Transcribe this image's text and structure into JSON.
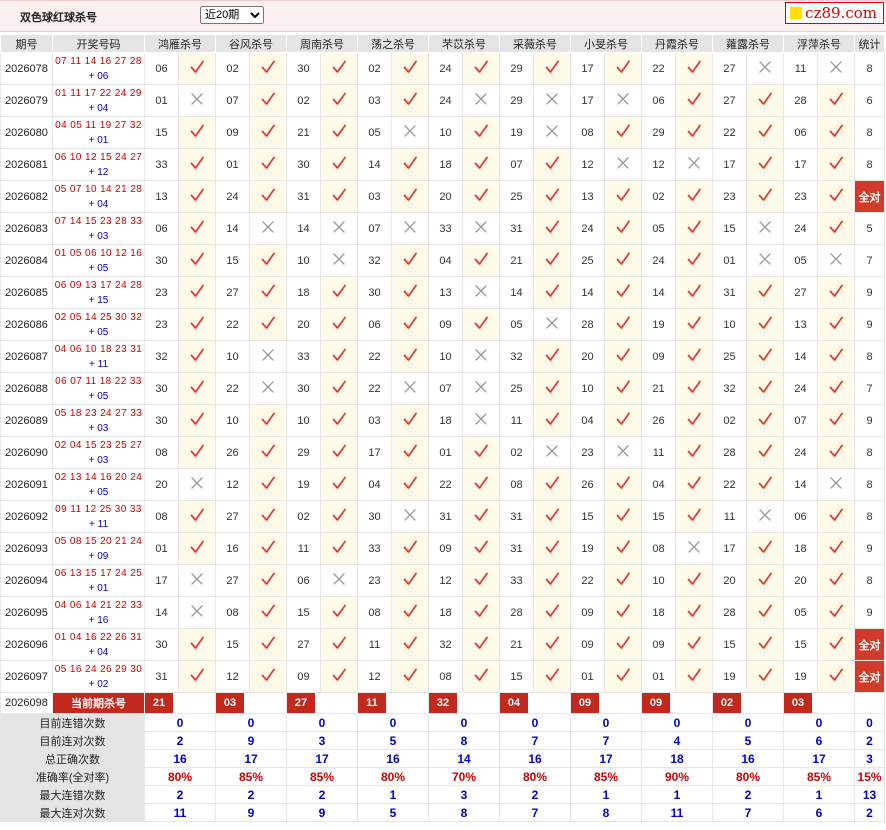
{
  "header": {
    "title": "双色球红球杀号",
    "period_select": {
      "selected": "近20期",
      "options": [
        "近20期"
      ]
    },
    "logo": "cz89.com"
  },
  "columns": [
    "期号",
    "开奖号码",
    "鸿雁杀号",
    "谷风杀号",
    "周南杀号",
    "荡之杀号",
    "芣苡杀号",
    "采薇杀号",
    "小旻杀号",
    "丹霞杀号",
    "蕹露杀号",
    "浮萍杀号",
    "统计"
  ],
  "rows": [
    {
      "issue": "2026078",
      "red": "07 11 14 16 27 28",
      "blue": "+ 06",
      "picks": [
        [
          "06",
          1
        ],
        [
          "02",
          1
        ],
        [
          "30",
          1
        ],
        [
          "02",
          1
        ],
        [
          "24",
          1
        ],
        [
          "29",
          1
        ],
        [
          "17",
          1
        ],
        [
          "22",
          1
        ],
        [
          "27",
          0
        ],
        [
          "11",
          0
        ]
      ],
      "stat": "8"
    },
    {
      "issue": "2026079",
      "red": "01 11 17 22 24 29",
      "blue": "+ 04",
      "picks": [
        [
          "01",
          0
        ],
        [
          "07",
          1
        ],
        [
          "02",
          1
        ],
        [
          "03",
          1
        ],
        [
          "24",
          0
        ],
        [
          "29",
          0
        ],
        [
          "17",
          0
        ],
        [
          "06",
          1
        ],
        [
          "27",
          1
        ],
        [
          "28",
          1
        ]
      ],
      "stat": "6"
    },
    {
      "issue": "2026080",
      "red": "04 05 11 19 27 32",
      "blue": "+ 01",
      "picks": [
        [
          "15",
          1
        ],
        [
          "09",
          1
        ],
        [
          "21",
          1
        ],
        [
          "05",
          0
        ],
        [
          "10",
          1
        ],
        [
          "19",
          0
        ],
        [
          "08",
          1
        ],
        [
          "29",
          1
        ],
        [
          "22",
          1
        ],
        [
          "06",
          1
        ]
      ],
      "stat": "8"
    },
    {
      "issue": "2026081",
      "red": "06 10 12 15 24 27",
      "blue": "+ 12",
      "picks": [
        [
          "33",
          1
        ],
        [
          "01",
          1
        ],
        [
          "30",
          1
        ],
        [
          "14",
          1
        ],
        [
          "18",
          1
        ],
        [
          "07",
          1
        ],
        [
          "12",
          0
        ],
        [
          "12",
          0
        ],
        [
          "17",
          1
        ],
        [
          "17",
          1
        ]
      ],
      "stat": "8"
    },
    {
      "issue": "2026082",
      "red": "05 07 10 14 21 28",
      "blue": "+ 04",
      "picks": [
        [
          "13",
          1
        ],
        [
          "24",
          1
        ],
        [
          "31",
          1
        ],
        [
          "03",
          1
        ],
        [
          "20",
          1
        ],
        [
          "25",
          1
        ],
        [
          "13",
          1
        ],
        [
          "02",
          1
        ],
        [
          "23",
          1
        ],
        [
          "23",
          1
        ]
      ],
      "stat": "全对"
    },
    {
      "issue": "2026083",
      "red": "07 14 15 23 28 33",
      "blue": "+ 03",
      "picks": [
        [
          "06",
          1
        ],
        [
          "14",
          0
        ],
        [
          "14",
          0
        ],
        [
          "07",
          0
        ],
        [
          "33",
          0
        ],
        [
          "31",
          1
        ],
        [
          "24",
          1
        ],
        [
          "05",
          1
        ],
        [
          "15",
          0
        ],
        [
          "24",
          1
        ]
      ],
      "stat": "5"
    },
    {
      "issue": "2026084",
      "red": "01 05 06 10 12 16",
      "blue": "+ 05",
      "picks": [
        [
          "30",
          1
        ],
        [
          "15",
          1
        ],
        [
          "10",
          0
        ],
        [
          "32",
          1
        ],
        [
          "04",
          1
        ],
        [
          "21",
          1
        ],
        [
          "25",
          1
        ],
        [
          "24",
          1
        ],
        [
          "01",
          0
        ],
        [
          "05",
          0
        ]
      ],
      "stat": "7"
    },
    {
      "issue": "2026085",
      "red": "06 09 13 17 24 28",
      "blue": "+ 15",
      "picks": [
        [
          "23",
          1
        ],
        [
          "27",
          1
        ],
        [
          "18",
          1
        ],
        [
          "30",
          1
        ],
        [
          "13",
          0
        ],
        [
          "14",
          1
        ],
        [
          "14",
          1
        ],
        [
          "14",
          1
        ],
        [
          "31",
          1
        ],
        [
          "27",
          1
        ]
      ],
      "stat": "9"
    },
    {
      "issue": "2026086",
      "red": "02 05 14 25 30 32",
      "blue": "+ 05",
      "picks": [
        [
          "23",
          1
        ],
        [
          "22",
          1
        ],
        [
          "20",
          1
        ],
        [
          "06",
          1
        ],
        [
          "09",
          1
        ],
        [
          "05",
          0
        ],
        [
          "28",
          1
        ],
        [
          "19",
          1
        ],
        [
          "10",
          1
        ],
        [
          "13",
          1
        ]
      ],
      "stat": "9"
    },
    {
      "issue": "2026087",
      "red": "04 06 10 18 23 31",
      "blue": "+ 11",
      "picks": [
        [
          "32",
          1
        ],
        [
          "10",
          0
        ],
        [
          "33",
          1
        ],
        [
          "22",
          1
        ],
        [
          "10",
          0
        ],
        [
          "32",
          1
        ],
        [
          "20",
          1
        ],
        [
          "09",
          1
        ],
        [
          "25",
          1
        ],
        [
          "14",
          1
        ]
      ],
      "stat": "8"
    },
    {
      "issue": "2026088",
      "red": "06 07 11 18 22 33",
      "blue": "+ 05",
      "picks": [
        [
          "30",
          1
        ],
        [
          "22",
          0
        ],
        [
          "30",
          1
        ],
        [
          "22",
          0
        ],
        [
          "07",
          0
        ],
        [
          "25",
          1
        ],
        [
          "10",
          1
        ],
        [
          "21",
          1
        ],
        [
          "32",
          1
        ],
        [
          "24",
          1
        ]
      ],
      "stat": "7"
    },
    {
      "issue": "2026089",
      "red": "05 18 23 24 27 33",
      "blue": "+ 03",
      "picks": [
        [
          "30",
          1
        ],
        [
          "10",
          1
        ],
        [
          "10",
          1
        ],
        [
          "03",
          1
        ],
        [
          "18",
          0
        ],
        [
          "11",
          1
        ],
        [
          "04",
          1
        ],
        [
          "26",
          1
        ],
        [
          "02",
          1
        ],
        [
          "07",
          1
        ]
      ],
      "stat": "9"
    },
    {
      "issue": "2026090",
      "red": "02 04 15 23 25 27",
      "blue": "+ 03",
      "picks": [
        [
          "08",
          1
        ],
        [
          "26",
          1
        ],
        [
          "29",
          1
        ],
        [
          "17",
          1
        ],
        [
          "01",
          1
        ],
        [
          "02",
          0
        ],
        [
          "23",
          0
        ],
        [
          "11",
          1
        ],
        [
          "28",
          1
        ],
        [
          "24",
          1
        ]
      ],
      "stat": "8"
    },
    {
      "issue": "2026091",
      "red": "02 13 14 16 20 24",
      "blue": "+ 05",
      "picks": [
        [
          "20",
          0
        ],
        [
          "12",
          1
        ],
        [
          "19",
          1
        ],
        [
          "04",
          1
        ],
        [
          "22",
          1
        ],
        [
          "08",
          1
        ],
        [
          "26",
          1
        ],
        [
          "04",
          1
        ],
        [
          "22",
          1
        ],
        [
          "14",
          0
        ]
      ],
      "stat": "8"
    },
    {
      "issue": "2026092",
      "red": "09 11 12 25 30 33",
      "blue": "+ 11",
      "picks": [
        [
          "08",
          1
        ],
        [
          "27",
          1
        ],
        [
          "02",
          1
        ],
        [
          "30",
          0
        ],
        [
          "31",
          1
        ],
        [
          "31",
          1
        ],
        [
          "15",
          1
        ],
        [
          "15",
          1
        ],
        [
          "11",
          0
        ],
        [
          "06",
          1
        ]
      ],
      "stat": "8"
    },
    {
      "issue": "2026093",
      "red": "05 08 15 20 21 24",
      "blue": "+ 09",
      "picks": [
        [
          "01",
          1
        ],
        [
          "16",
          1
        ],
        [
          "11",
          1
        ],
        [
          "33",
          1
        ],
        [
          "09",
          1
        ],
        [
          "31",
          1
        ],
        [
          "19",
          1
        ],
        [
          "08",
          0
        ],
        [
          "17",
          1
        ],
        [
          "18",
          1
        ]
      ],
      "stat": "9"
    },
    {
      "issue": "2026094",
      "red": "06 13 15 17 24 25",
      "blue": "+ 01",
      "picks": [
        [
          "17",
          0
        ],
        [
          "27",
          1
        ],
        [
          "06",
          0
        ],
        [
          "23",
          1
        ],
        [
          "12",
          1
        ],
        [
          "33",
          1
        ],
        [
          "22",
          1
        ],
        [
          "10",
          1
        ],
        [
          "20",
          1
        ],
        [
          "20",
          1
        ]
      ],
      "stat": "8"
    },
    {
      "issue": "2026095",
      "red": "04 06 14 21 22 33",
      "blue": "+ 16",
      "picks": [
        [
          "14",
          0
        ],
        [
          "08",
          1
        ],
        [
          "15",
          1
        ],
        [
          "08",
          1
        ],
        [
          "18",
          1
        ],
        [
          "28",
          1
        ],
        [
          "09",
          1
        ],
        [
          "18",
          1
        ],
        [
          "28",
          1
        ],
        [
          "05",
          1
        ]
      ],
      "stat": "9"
    },
    {
      "issue": "2026096",
      "red": "01 04 16 22 26 31",
      "blue": "+ 04",
      "picks": [
        [
          "30",
          1
        ],
        [
          "15",
          1
        ],
        [
          "27",
          1
        ],
        [
          "11",
          1
        ],
        [
          "32",
          1
        ],
        [
          "21",
          1
        ],
        [
          "09",
          1
        ],
        [
          "09",
          1
        ],
        [
          "15",
          1
        ],
        [
          "15",
          1
        ]
      ],
      "stat": "全对"
    },
    {
      "issue": "2026097",
      "red": "05 16 24 26 29 30",
      "blue": "+ 02",
      "picks": [
        [
          "31",
          1
        ],
        [
          "12",
          1
        ],
        [
          "09",
          1
        ],
        [
          "12",
          1
        ],
        [
          "08",
          1
        ],
        [
          "15",
          1
        ],
        [
          "01",
          1
        ],
        [
          "01",
          1
        ],
        [
          "19",
          1
        ],
        [
          "19",
          1
        ]
      ],
      "stat": "全对"
    }
  ],
  "current": {
    "issue": "2026098",
    "label": "当前期杀号",
    "picks": [
      "21",
      "03",
      "27",
      "11",
      "32",
      "04",
      "09",
      "09",
      "02",
      "03"
    ]
  },
  "summary": [
    {
      "label": "目前连错次数",
      "color": "blue",
      "values": [
        "0",
        "0",
        "0",
        "0",
        "0",
        "0",
        "0",
        "0",
        "0",
        "0"
      ],
      "stat": "0"
    },
    {
      "label": "目前连对次数",
      "color": "blue",
      "values": [
        "2",
        "9",
        "3",
        "5",
        "8",
        "7",
        "7",
        "4",
        "5",
        "6"
      ],
      "stat": "2"
    },
    {
      "label": "总正确次数",
      "color": "blue",
      "values": [
        "16",
        "17",
        "17",
        "16",
        "14",
        "16",
        "17",
        "18",
        "16",
        "17"
      ],
      "stat": "3"
    },
    {
      "label": "准确率(全对率)",
      "color": "red",
      "values": [
        "80%",
        "85%",
        "85%",
        "80%",
        "70%",
        "80%",
        "85%",
        "90%",
        "80%",
        "85%"
      ],
      "stat": "15%"
    },
    {
      "label": "最大连错次数",
      "color": "blue",
      "values": [
        "2",
        "2",
        "2",
        "1",
        "3",
        "2",
        "1",
        "1",
        "2",
        "1"
      ],
      "stat": "13"
    },
    {
      "label": "最大连对次数",
      "color": "blue",
      "values": [
        "11",
        "9",
        "9",
        "5",
        "8",
        "7",
        "8",
        "11",
        "7",
        "6"
      ],
      "stat": "2"
    }
  ],
  "colors": {
    "accent_red": "#c3281c",
    "tick_red": "#e53935",
    "cross_gray": "#9a9a9a",
    "header_gray": "#e4e4e4",
    "blue_text": "#0000cc"
  }
}
